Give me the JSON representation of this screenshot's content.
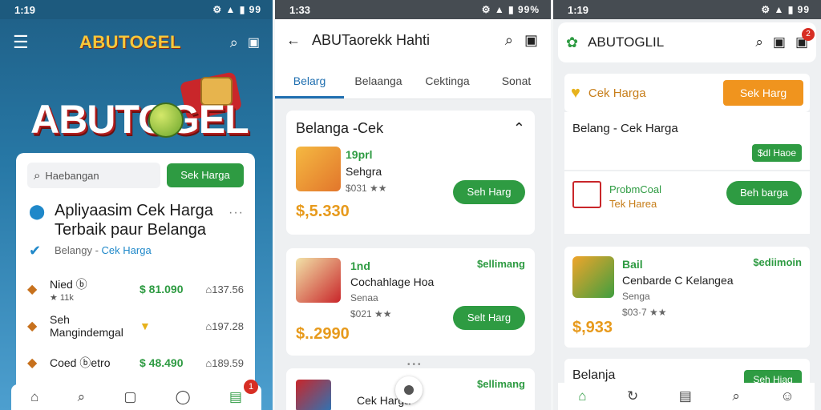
{
  "phone1": {
    "status": {
      "time": "1:19",
      "icons": "⚙ ▲ ▮ 99"
    },
    "app_title": "ABUTOGEL",
    "hero_title": "ABUTOGEL",
    "search": {
      "placeholder": "Haebangan",
      "button": "Sek Harga"
    },
    "headline": {
      "title": "Apliyaasim Cek Harga Terbaik paur Belanga",
      "sub_prefix": "Belangy - ",
      "sub_link": "Cek Harga"
    },
    "rows": [
      {
        "name": "Nied ⓑ",
        "rating": "★ 11k",
        "price": "$ 81.090",
        "count": "⌂137.56"
      },
      {
        "name": "Seh Mangindemgal",
        "rating": "",
        "price": "",
        "count": "⌂197.28"
      },
      {
        "name": "Coed ⓑetro",
        "rating": "",
        "price": "$ 48.490",
        "count": "⌂189.59"
      }
    ],
    "nav_badge": "1"
  },
  "phone2": {
    "status": {
      "time": "1:33",
      "icons": "⚙ ▲ ▮ 99%"
    },
    "title": "ABUTaorekk Hahti",
    "tabs": [
      "Belarg",
      "Belaanga",
      "Cektinga",
      "Sonat"
    ],
    "section_title": "Belanga -Cek",
    "items": [
      {
        "tag": "19prl",
        "name": "Sehgra",
        "meta": "$031 ★★",
        "price": "$,5.330",
        "button": "Seh Harg",
        "stock": ""
      },
      {
        "tag": "1nd",
        "name": "Cochahlage Hoa",
        "meta": "$021 ★★",
        "price": "$..2990",
        "button": "Selt Harg",
        "stock": "$ellimang",
        "sub": "Senaa"
      },
      {
        "tag": "",
        "name": "Cek Harga",
        "meta": "",
        "price": "",
        "button": "",
        "stock": "$ellimang"
      }
    ]
  },
  "phone3": {
    "status": {
      "time": "1:19",
      "icons": "⚙ ▲ ▮ 99"
    },
    "title": "ABUTOGLIL",
    "badge": "2",
    "header_label": "Cek Harga",
    "header_button": "Sek Harg",
    "row1_title": "Belang - Cek Harga",
    "row1_button": "$dl Haoe",
    "row2_title": "ProbmCoal",
    "row2_sub": "Tek Harea",
    "row2_button": "Beh barga",
    "row3": {
      "tag": "Bail",
      "name": "Cenbarde C Kelangea",
      "sub": "Senga",
      "meta": "$03·7 ★★",
      "price": "$,933",
      "stock": "$ediimoin"
    },
    "row4_title": "Belanja",
    "row4_button": "Seh Hiag"
  }
}
